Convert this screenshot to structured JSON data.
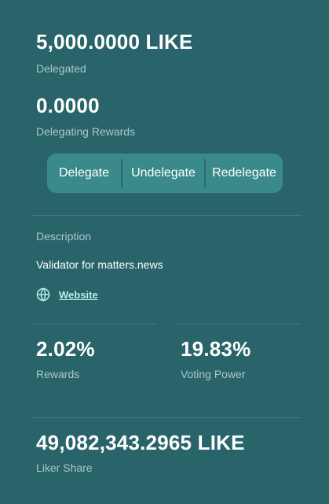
{
  "delegated": {
    "value": "5,000.0000 LIKE",
    "label": "Delegated"
  },
  "delegating_rewards": {
    "value": "0.0000",
    "label": "Delegating Rewards"
  },
  "actions": {
    "delegate_label": "Delegate",
    "undelegate_label": "Undelegate",
    "redelegate_label": "Redelegate"
  },
  "description": {
    "heading": "Description",
    "text": "Validator for matters.news",
    "website_icon": "globe-icon",
    "website_label": "Website"
  },
  "stats": {
    "rewards_value": "2.02%",
    "rewards_label": "Rewards",
    "voting_power_value": "19.83%",
    "voting_power_label": "Voting Power"
  },
  "liker_share": {
    "value": "49,082,343.2965 LIKE",
    "label": "Liker Share"
  },
  "colors": {
    "background": "#28646a",
    "button_group": "#3a8a8a",
    "muted_text": "#a9c8ca",
    "link": "#b6f0ea",
    "divider": "#3f7a7f"
  }
}
